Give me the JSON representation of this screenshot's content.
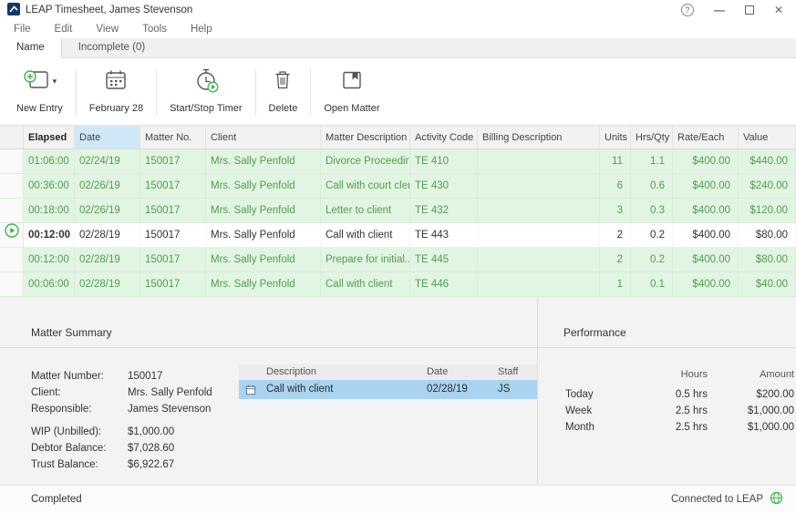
{
  "window": {
    "title": "LEAP Timesheet, James Stevenson",
    "controls": {
      "help": "?",
      "minimize": "—",
      "close": "✕"
    }
  },
  "menu": {
    "items": [
      {
        "label": "File"
      },
      {
        "label": "Edit"
      },
      {
        "label": "View"
      },
      {
        "label": "Tools"
      },
      {
        "label": "Help"
      }
    ]
  },
  "tabs": {
    "items": [
      {
        "label": "Name"
      },
      {
        "label": "Incomplete (0)"
      }
    ]
  },
  "toolbar": {
    "new_entry": "New Entry",
    "date": "February 28",
    "timer": "Start/Stop Timer",
    "delete": "Delete",
    "open_matter": "Open Matter"
  },
  "grid": {
    "headers": {
      "elapsed": "Elapsed",
      "date": "Date",
      "matter_no": "Matter No.",
      "client": "Client",
      "matter_description": "Matter Description",
      "activity_code": "Activity Code",
      "billing_description": "Billing Description",
      "units": "Units",
      "hrs_qty": "Hrs/Qty",
      "rate_each": "Rate/Each",
      "value": "Value"
    },
    "rows": [
      {
        "elapsed": "01:06:00",
        "date": "02/24/19",
        "matter_no": "150017",
        "client": "Mrs. Sally Penfold",
        "matter_description": "Divorce Proceedin...",
        "activity_code": "TE 410",
        "billing_description": "",
        "units": "11",
        "hrs_qty": "1.1",
        "rate_each": "$400.00",
        "value": "$440.00"
      },
      {
        "elapsed": "00:36:00",
        "date": "02/26/19",
        "matter_no": "150017",
        "client": "Mrs. Sally Penfold",
        "matter_description": "Call with court clerk",
        "activity_code": "TE 430",
        "billing_description": "",
        "units": "6",
        "hrs_qty": "0.6",
        "rate_each": "$400.00",
        "value": "$240.00"
      },
      {
        "elapsed": "00:18:00",
        "date": "02/26/19",
        "matter_no": "150017",
        "client": "Mrs. Sally Penfold",
        "matter_description": "Letter to client",
        "activity_code": "TE 432",
        "billing_description": "",
        "units": "3",
        "hrs_qty": "0.3",
        "rate_each": "$400.00",
        "value": "$120.00"
      },
      {
        "elapsed": "00:12:00",
        "date": "02/28/19",
        "matter_no": "150017",
        "client": "Mrs. Sally Penfold",
        "matter_description": "Call with client",
        "activity_code": "TE 443",
        "billing_description": "",
        "units": "2",
        "hrs_qty": "0.2",
        "rate_each": "$400.00",
        "value": "$80.00"
      },
      {
        "elapsed": "00:12:00",
        "date": "02/28/19",
        "matter_no": "150017",
        "client": "Mrs. Sally Penfold",
        "matter_description": "Prepare for initial...",
        "activity_code": "TE 445",
        "billing_description": "",
        "units": "2",
        "hrs_qty": "0.2",
        "rate_each": "$400.00",
        "value": "$80.00"
      },
      {
        "elapsed": "00:06:00",
        "date": "02/28/19",
        "matter_no": "150017",
        "client": "Mrs. Sally Penfold",
        "matter_description": "Call with client",
        "activity_code": "TE 446",
        "billing_description": "",
        "units": "1",
        "hrs_qty": "0.1",
        "rate_each": "$400.00",
        "value": "$40.00"
      }
    ]
  },
  "matter_summary": {
    "title": "Matter Summary",
    "fields": [
      {
        "label": "Matter Number:",
        "value": "150017"
      },
      {
        "label": "Client:",
        "value": "Mrs. Sally Penfold"
      },
      {
        "label": "Responsible:",
        "value": "James Stevenson"
      },
      {
        "label": "WIP (Unbilled):",
        "value": "$1,000.00"
      },
      {
        "label": "Debtor Balance:",
        "value": "$7,028.60"
      },
      {
        "label": "Trust Balance:",
        "value": "$6,922.67"
      }
    ],
    "entries": {
      "headers": {
        "description": "Description",
        "date": "Date",
        "staff": "Staff"
      },
      "rows": [
        {
          "description": "Call with client",
          "date": "02/28/19",
          "staff": "JS"
        }
      ]
    }
  },
  "performance": {
    "title": "Performance",
    "headers": {
      "hours": "Hours",
      "amount": "Amount"
    },
    "rows": [
      {
        "label": "Today",
        "hours": "0.5 hrs",
        "amount": "$200.00"
      },
      {
        "label": "Week",
        "hours": "2.5 hrs",
        "amount": "$1,000.00"
      },
      {
        "label": "Month",
        "hours": "2.5 hrs",
        "amount": "$1,000.00"
      }
    ]
  },
  "status_bar": {
    "left": "Completed",
    "right": "Connected to LEAP"
  },
  "colors": {
    "accent_green": "#3cb54a",
    "row_green_bg": "#e2f5e2",
    "row_green_text": "#4f9d4f",
    "selected_blue": "#a9d3f0",
    "sorted_header_blue": "#cfe7f6",
    "logo_blue": "#123a68"
  }
}
